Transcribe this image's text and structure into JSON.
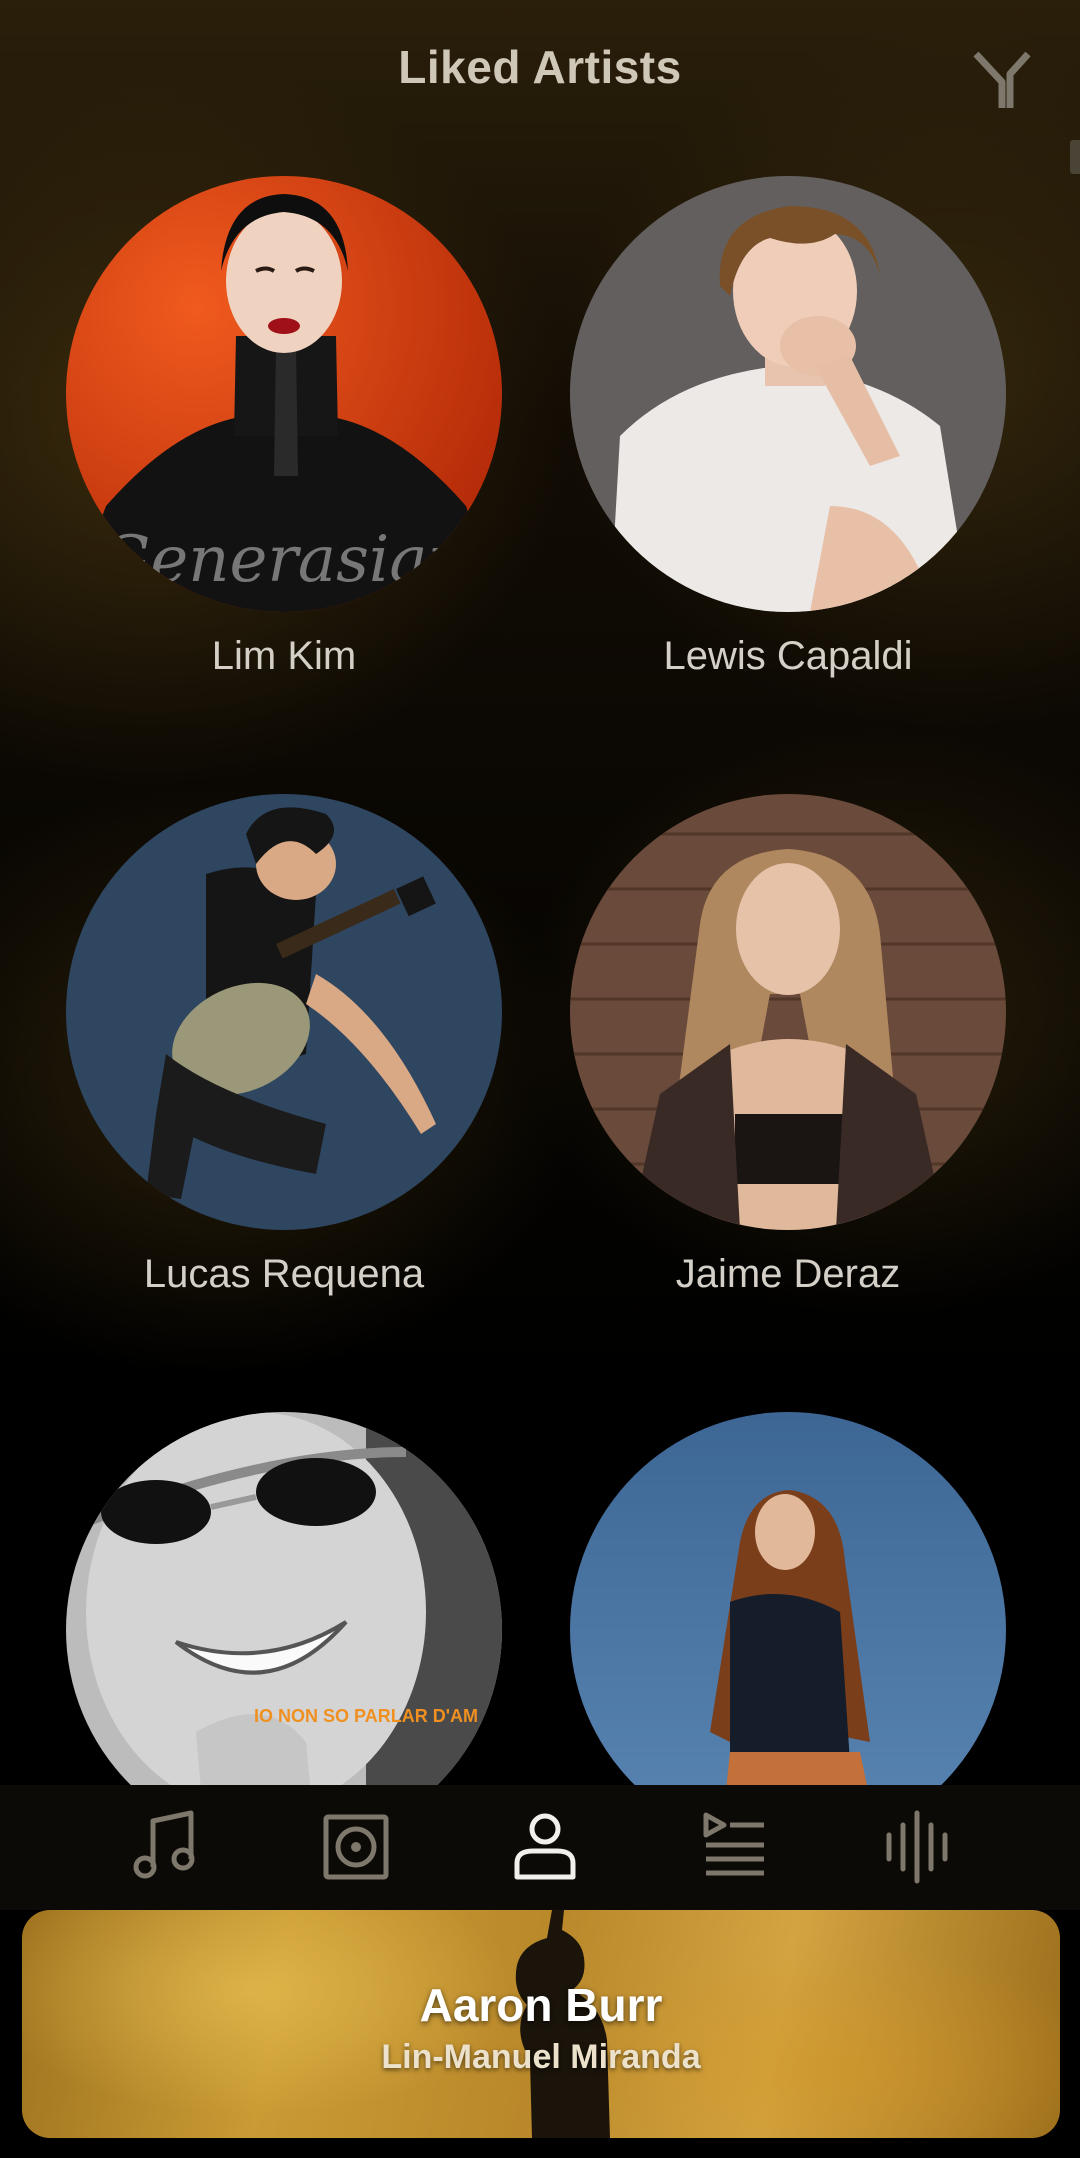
{
  "header": {
    "title": "Liked Artists",
    "filter_icon": "filter-y-icon"
  },
  "artists": [
    {
      "name": "Lim Kim",
      "cover_text": "Generasian"
    },
    {
      "name": "Lewis Capaldi"
    },
    {
      "name": "Lucas Requena"
    },
    {
      "name": "Jaime Deraz"
    },
    {
      "name": "",
      "cover_text": "IO NON SO PARLAR D'AM"
    },
    {
      "name": ""
    }
  ],
  "bottom_nav": {
    "items": [
      {
        "icon": "music-note-icon",
        "label": "Songs"
      },
      {
        "icon": "album-icon",
        "label": "Albums"
      },
      {
        "icon": "person-icon",
        "label": "Artists",
        "active": true
      },
      {
        "icon": "playlist-icon",
        "label": "Playlists"
      },
      {
        "icon": "waveform-icon",
        "label": "Genres"
      }
    ]
  },
  "now_playing": {
    "title": "Aaron Burr",
    "artist": "Lin-Manuel Miranda"
  },
  "colors": {
    "accent_active": "#f2f0ea",
    "inactive_icon": "#7e786c",
    "text_primary": "#d4d0c8"
  }
}
